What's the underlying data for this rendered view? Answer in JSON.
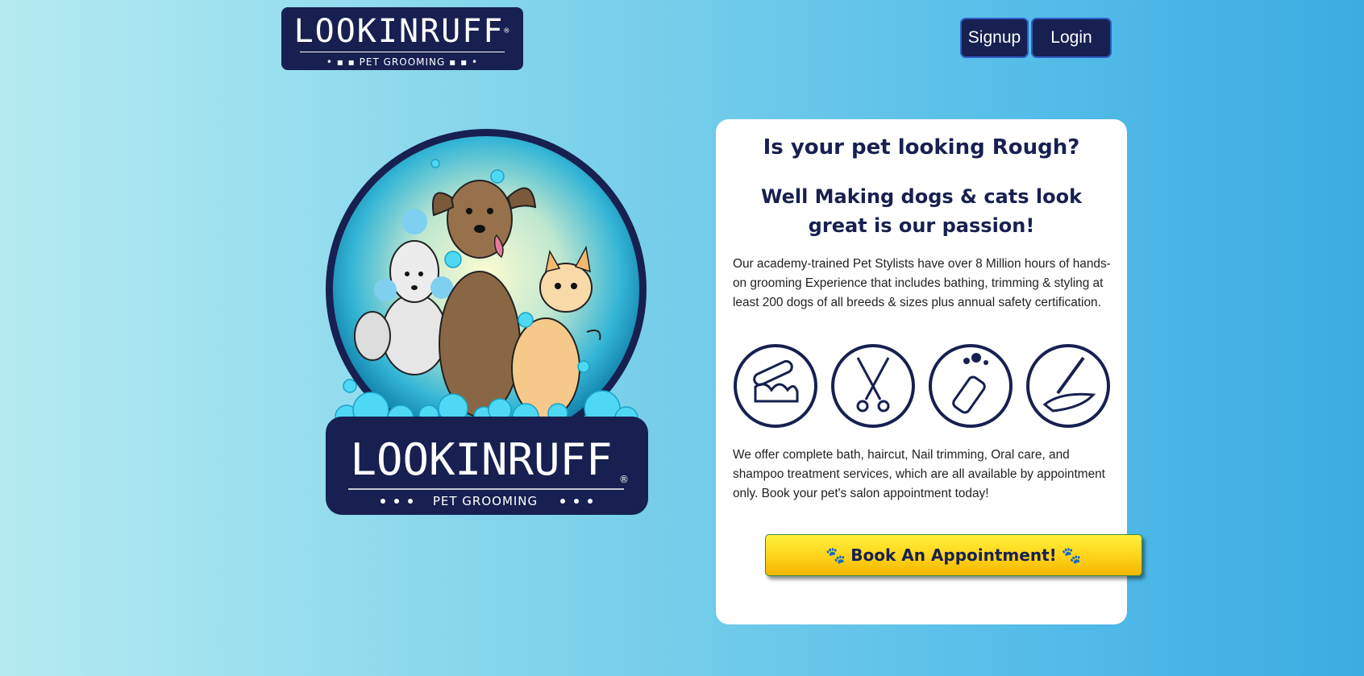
{
  "header": {
    "logo_name": "LOOKINRUFF",
    "logo_reg": "®",
    "logo_tagline": "PET GROOMING",
    "signup_label": "Signup",
    "login_label": "Login"
  },
  "hero": {
    "logo_name": "LOOKINRUFF",
    "logo_reg": "®",
    "logo_tagline": "PET GROOMING"
  },
  "card": {
    "title": "Is your pet looking Rough?",
    "subtitle": "Well Making dogs & cats look great is our passion!",
    "intro": "Our academy-trained Pet Stylists have over 8 Million hours of hands-on grooming Experience that includes bathing, trimming & styling at least 200 dogs of all breeds & sizes plus annual safety certification.",
    "services_icons": [
      "nail-trimming-icon",
      "scissors-icon",
      "shampoo-bottle-icon",
      "toothbrush-icon"
    ],
    "services_text": "We offer complete bath, haircut, Nail trimming, Oral care, and shampoo treatment services, which are all available by appointment only. Book your pet's salon appointment today!",
    "book_label": "Book An Appointment!"
  },
  "colors": {
    "navy": "#172050",
    "accent_yellow": "#ffd21a",
    "bubble_blue": "#4fd8f3"
  }
}
